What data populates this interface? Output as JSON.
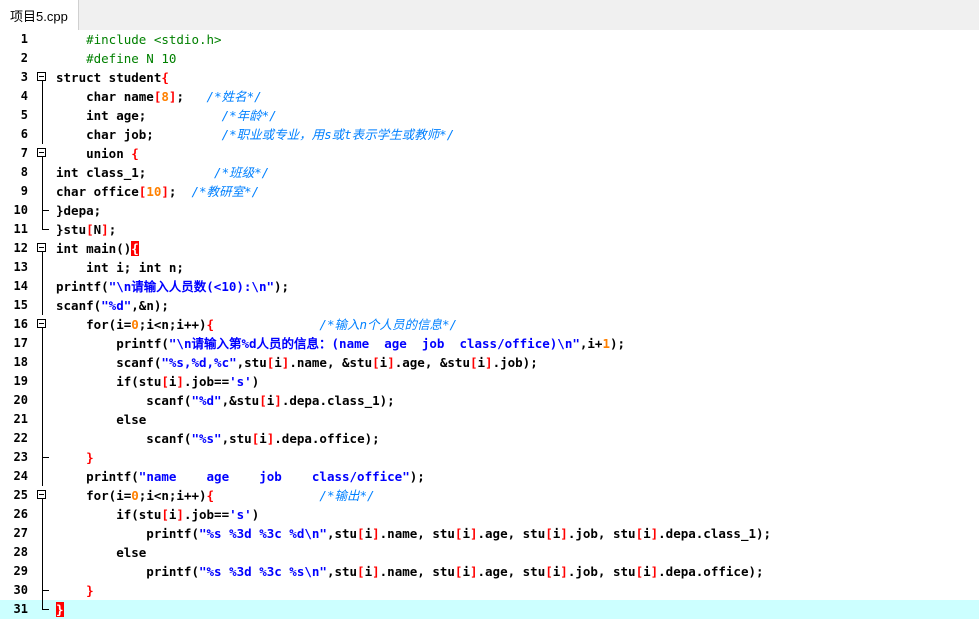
{
  "tab": {
    "title": "项目5.cpp"
  },
  "lines": [
    {
      "n": "1",
      "fold": "",
      "html": "<span class='pp'>    #include &lt;stdio.h&gt;</span>"
    },
    {
      "n": "2",
      "fold": "",
      "html": "<span class='pp'>    #define N 10</span>"
    },
    {
      "n": "3",
      "fold": "open",
      "html": "struct student<span class='br'>{</span>"
    },
    {
      "n": "4",
      "fold": "v",
      "html": "    char name<span class='br'>[</span><span class='num'>8</span><span class='br'>]</span>;   <span class='cmt'>/*姓名*/</span>"
    },
    {
      "n": "5",
      "fold": "v",
      "html": "    int age;          <span class='cmt'>/*年龄*/</span>"
    },
    {
      "n": "6",
      "fold": "v",
      "html": "    char job;         <span class='cmt'>/*职业或专业，用s或t表示学生或教师*/</span>"
    },
    {
      "n": "7",
      "fold": "open",
      "html": "    union <span class='br'>{</span>"
    },
    {
      "n": "8",
      "fold": "v",
      "html": "int class_1;         <span class='cmt'>/*班级*/</span>"
    },
    {
      "n": "9",
      "fold": "v",
      "html": "char office<span class='br'>[</span><span class='num'>10</span><span class='br'>]</span>;  <span class='cmt'>/*教研室*/</span>"
    },
    {
      "n": "10",
      "fold": "mid",
      "html": "}depa;"
    },
    {
      "n": "11",
      "fold": "end",
      "html": "}stu<span class='br'>[</span>N<span class='br'>]</span>;"
    },
    {
      "n": "12",
      "fold": "open",
      "html": "int main()<span class='hl'>{</span>"
    },
    {
      "n": "13",
      "fold": "v",
      "html": "    int i; int n;"
    },
    {
      "n": "14",
      "fold": "v",
      "html": "printf(<span class='str'>\"\\n请输入人员数(&lt;10):\\n\"</span>);"
    },
    {
      "n": "15",
      "fold": "v",
      "html": "scanf(<span class='str'>\"%d\"</span>,&amp;n);"
    },
    {
      "n": "16",
      "fold": "open",
      "html": "    for(i=<span class='num'>0</span>;i&lt;n;i++)<span class='br'>{</span>              <span class='cmt'>/*输入n个人员的信息*/</span>"
    },
    {
      "n": "17",
      "fold": "v",
      "html": "        printf(<span class='str'>\"\\n请输入第%d人员的信息：(name  age  job  class/office)\\n\"</span>,i+<span class='num'>1</span>);"
    },
    {
      "n": "18",
      "fold": "v",
      "html": "        scanf(<span class='str'>\"%s,%d,%c\"</span>,stu<span class='br'>[</span>i<span class='br'>]</span>.name, &amp;stu<span class='br'>[</span>i<span class='br'>]</span>.age, &amp;stu<span class='br'>[</span>i<span class='br'>]</span>.job);"
    },
    {
      "n": "19",
      "fold": "v",
      "html": "        if(stu<span class='br'>[</span>i<span class='br'>]</span>.job==<span class='str'>'s'</span>)"
    },
    {
      "n": "20",
      "fold": "v",
      "html": "            scanf(<span class='str'>\"%d\"</span>,&amp;stu<span class='br'>[</span>i<span class='br'>]</span>.depa.class_1);"
    },
    {
      "n": "21",
      "fold": "v",
      "html": "        else"
    },
    {
      "n": "22",
      "fold": "v",
      "html": "            scanf(<span class='str'>\"%s\"</span>,stu<span class='br'>[</span>i<span class='br'>]</span>.depa.office);"
    },
    {
      "n": "23",
      "fold": "mid",
      "html": "    <span class='br'>}</span>"
    },
    {
      "n": "24",
      "fold": "v",
      "html": "    printf(<span class='str'>\"name    age    job    class/office\"</span>);"
    },
    {
      "n": "25",
      "fold": "open",
      "html": "    for(i=<span class='num'>0</span>;i&lt;n;i++)<span class='br'>{</span>              <span class='cmt'>/*输出*/</span>"
    },
    {
      "n": "26",
      "fold": "v",
      "html": "        if(stu<span class='br'>[</span>i<span class='br'>]</span>.job==<span class='str'>'s'</span>)"
    },
    {
      "n": "27",
      "fold": "v",
      "html": "            printf(<span class='str'>\"%s %3d %3c %d\\n\"</span>,stu<span class='br'>[</span>i<span class='br'>]</span>.name, stu<span class='br'>[</span>i<span class='br'>]</span>.age, stu<span class='br'>[</span>i<span class='br'>]</span>.job, stu<span class='br'>[</span>i<span class='br'>]</span>.depa.class_1);"
    },
    {
      "n": "28",
      "fold": "v",
      "html": "        else"
    },
    {
      "n": "29",
      "fold": "v",
      "html": "            printf(<span class='str'>\"%s %3d %3c %s\\n\"</span>,stu<span class='br'>[</span>i<span class='br'>]</span>.name, stu<span class='br'>[</span>i<span class='br'>]</span>.age, stu<span class='br'>[</span>i<span class='br'>]</span>.job, stu<span class='br'>[</span>i<span class='br'>]</span>.depa.office);"
    },
    {
      "n": "30",
      "fold": "mid",
      "html": "    <span class='br'>}</span>"
    },
    {
      "n": "31",
      "fold": "end",
      "html": "<span class='hl'>}</span>"
    }
  ],
  "current_line": "31"
}
